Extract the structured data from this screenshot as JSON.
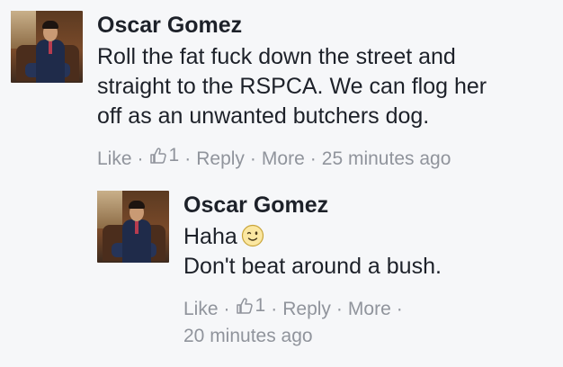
{
  "comments": {
    "top": {
      "author": "Oscar Gomez",
      "lines": [
        "Roll the fat fuck down the street and",
        "straight to the RSPCA. We can flog her",
        "off as an unwanted butchers dog."
      ],
      "like_label": "Like",
      "like_count": "1",
      "reply_label": "Reply",
      "more_label": "More",
      "timestamp": "25 minutes ago"
    },
    "reply": {
      "author": "Oscar Gomez",
      "line1": "Haha",
      "emoji_name": "wink-emoji",
      "line2": "Don't beat around a bush.",
      "like_label": "Like",
      "like_count": "1",
      "reply_label": "Reply",
      "more_label": "More",
      "timestamp": "20 minutes ago"
    }
  },
  "colors": {
    "background": "#f6f7f9",
    "text": "#1d2129",
    "meta": "#90949c"
  }
}
